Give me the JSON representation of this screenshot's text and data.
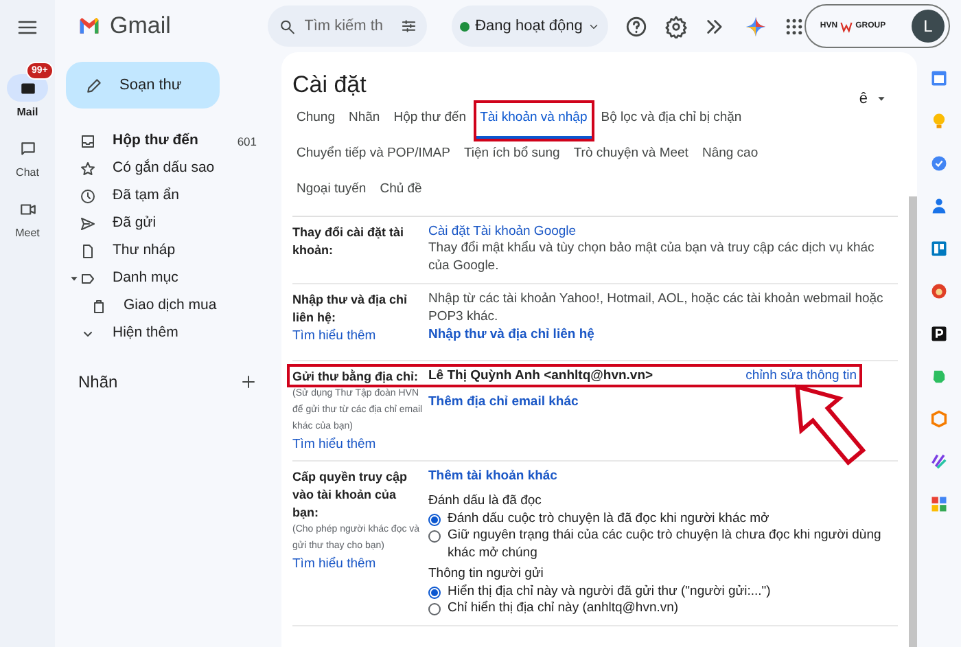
{
  "app": {
    "name": "Gmail"
  },
  "search": {
    "placeholder": "Tìm kiếm th"
  },
  "status": {
    "label": "Đang hoạt động"
  },
  "account": {
    "org": "HVN",
    "org_suffix": "GROUP",
    "avatar": "L"
  },
  "rail": [
    {
      "label": "Mail",
      "selected": true,
      "badge": "99+"
    },
    {
      "label": "Chat",
      "selected": false
    },
    {
      "label": "Meet",
      "selected": false
    }
  ],
  "compose": {
    "label": "Soạn thư"
  },
  "folders": [
    {
      "label": "Hộp thư đến",
      "count": "601",
      "selected": true
    },
    {
      "label": "Có gắn dấu sao",
      "selected": false
    },
    {
      "label": "Đã tạm ẩn",
      "selected": false
    },
    {
      "label": "Đã gửi",
      "selected": false
    },
    {
      "label": "Thư nháp",
      "selected": false
    },
    {
      "label": "Danh mục",
      "selected": false,
      "expanded": true,
      "children": [
        {
          "label": "Giao dịch mua",
          "selected": false
        }
      ]
    },
    {
      "label": "Hiện thêm",
      "selected": false
    }
  ],
  "labels_heading": "Nhãn",
  "settings": {
    "title": "Cài đặt",
    "language": "ê",
    "tabs": [
      {
        "label": "Chung",
        "selected": false,
        "highlighted": false
      },
      {
        "label": "Nhãn",
        "selected": false,
        "highlighted": false
      },
      {
        "label": "Hộp thư đến",
        "selected": false,
        "highlighted": false
      },
      {
        "label": "Tài khoản và nhập",
        "selected": true,
        "highlighted": true
      },
      {
        "label": "Bộ lọc và địa chỉ bị chặn",
        "selected": false,
        "highlighted": false
      },
      {
        "label": "Chuyển tiếp và POP/IMAP",
        "selected": false,
        "highlighted": false
      },
      {
        "label": "Tiện ích bổ sung",
        "selected": false,
        "highlighted": false
      },
      {
        "label": "Trò chuyện và Meet",
        "selected": false,
        "highlighted": false
      },
      {
        "label": "Nâng cao",
        "selected": false,
        "highlighted": false
      },
      {
        "label": "Ngoại tuyến",
        "selected": false,
        "highlighted": false
      },
      {
        "label": "Chủ đề",
        "selected": false,
        "highlighted": false
      }
    ],
    "rows": [
      {
        "label": "Thay đổi cài đặt tài khoản:",
        "highlighted": false,
        "content": [
          {
            "kind": "link",
            "text": "Cài đặt Tài khoản Google"
          },
          {
            "kind": "text",
            "text": "Thay đổi mật khẩu và tùy chọn bảo mật của bạn và truy cập các dịch vụ khác của Google."
          }
        ]
      },
      {
        "label": "Nhập thư và địa chỉ liên hệ:",
        "learn_more": "Tìm hiểu thêm",
        "highlighted": false,
        "content": [
          {
            "kind": "text",
            "text": "Nhập từ các tài khoản Yahoo!, Hotmail, AOL, hoặc các tài khoản webmail hoặc POP3 khác."
          },
          {
            "kind": "action",
            "text": "Nhập thư và địa chỉ liên hệ"
          }
        ]
      },
      {
        "label": "Gửi thư bằng địa chỉ:",
        "note": "(Sử dụng Thư Tập đoàn HVN để gửi thư từ các địa chỉ email khác của bạn)",
        "learn_more": "Tìm hiểu thêm",
        "highlighted": true,
        "content": [
          {
            "kind": "address",
            "text": "Lê Thị Quỳnh Anh <anhltq@hvn.vn>",
            "action": "chỉnh sửa thông tin"
          },
          {
            "kind": "action",
            "text": "Thêm địa chỉ email khác"
          }
        ]
      },
      {
        "label": "Cấp quyền truy cập vào tài khoản của bạn:",
        "note": "(Cho phép người khác đọc và gửi thư thay cho bạn)",
        "learn_more": "Tìm hiểu thêm",
        "highlighted": false,
        "content": [
          {
            "kind": "action",
            "text": "Thêm tài khoản khác"
          },
          {
            "kind": "heading",
            "text": "Đánh dấu là đã đọc"
          },
          {
            "kind": "radio",
            "text": "Đánh dấu cuộc trò chuyện là đã đọc khi người khác mở",
            "selected": true
          },
          {
            "kind": "radio",
            "text": "Giữ nguyên trạng thái của các cuộc trò chuyện là chưa đọc khi người dùng khác mở chúng",
            "selected": false
          },
          {
            "kind": "heading",
            "text": "Thông tin người gửi"
          },
          {
            "kind": "radio",
            "text": "Hiển thị địa chỉ này và người đã gửi thư (\"người gửi:...\")",
            "selected": true
          },
          {
            "kind": "radio",
            "text": "Chỉ hiển thị địa chỉ này (anhltq@hvn.vn)",
            "selected": false
          }
        ]
      }
    ]
  }
}
